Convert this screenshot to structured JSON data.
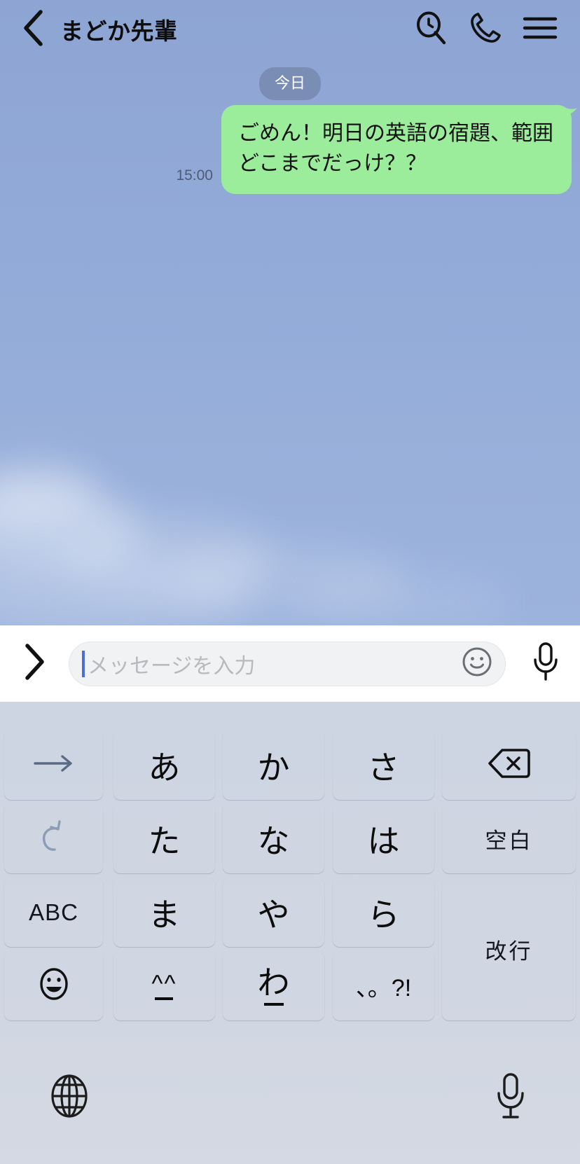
{
  "header": {
    "back_icon": "chevron-left-icon",
    "title": "まどか先輩",
    "search_icon": "search-clock-icon",
    "call_icon": "phone-icon",
    "menu_icon": "hamburger-menu-icon"
  },
  "chat": {
    "date_divider": "今日",
    "messages": [
      {
        "side": "outgoing",
        "text": "ごめん！明日の英語の宿題、範囲どこまでだっけ？？",
        "time": "15:00"
      }
    ]
  },
  "input_bar": {
    "expand_icon": "chevron-right-icon",
    "placeholder": "メッセージを入力",
    "value": "",
    "emoji_icon": "smiley-face-icon",
    "mic_icon": "microphone-icon"
  },
  "keyboard": {
    "rows": [
      [
        {
          "label": "→",
          "name": "cursor-right-key",
          "type": "gray-icon"
        },
        {
          "label": "あ",
          "name": "kana-a-key",
          "type": "white-char"
        },
        {
          "label": "か",
          "name": "kana-ka-key",
          "type": "white-char"
        },
        {
          "label": "さ",
          "name": "kana-sa-key",
          "type": "white-char"
        },
        {
          "label": "⌫",
          "name": "backspace-key",
          "type": "gray-icon"
        }
      ],
      [
        {
          "label": "↺",
          "name": "undo-key",
          "type": "gray-icon-dim"
        },
        {
          "label": "た",
          "name": "kana-ta-key",
          "type": "white-char"
        },
        {
          "label": "な",
          "name": "kana-na-key",
          "type": "white-char"
        },
        {
          "label": "は",
          "name": "kana-ha-key",
          "type": "white-char"
        },
        {
          "label": "空白",
          "name": "space-key",
          "type": "gray-label"
        }
      ],
      [
        {
          "label": "ABC",
          "name": "abc-mode-key",
          "type": "gray-label"
        },
        {
          "label": "ま",
          "name": "kana-ma-key",
          "type": "white-char"
        },
        {
          "label": "や",
          "name": "kana-ya-key",
          "type": "white-char"
        },
        {
          "label": "ら",
          "name": "kana-ra-key",
          "type": "white-char"
        },
        {
          "label": "改行",
          "name": "return-key",
          "type": "gray-label-tall"
        }
      ],
      [
        {
          "label": "☺",
          "name": "emoji-key",
          "type": "gray-icon"
        },
        {
          "label": "^_^",
          "name": "kaomoji-key",
          "type": "white-kaomoji"
        },
        {
          "label": "わ",
          "name": "kana-wa-key",
          "type": "white-char-underscore"
        },
        {
          "label": "、。?!",
          "name": "punctuation-key",
          "type": "white-punct"
        }
      ]
    ],
    "bottom": {
      "globe_icon": "globe-icon",
      "mic_icon": "microphone-icon"
    }
  },
  "colors": {
    "chat_background": "#91a9d7",
    "outgoing_bubble": "#9ced9b",
    "date_pill": "#6e7ea0",
    "keyboard_background": "#d0d6e2",
    "key_white": "#ffffff",
    "key_gray": "#aab7ce",
    "caret": "#4b6ddb"
  }
}
